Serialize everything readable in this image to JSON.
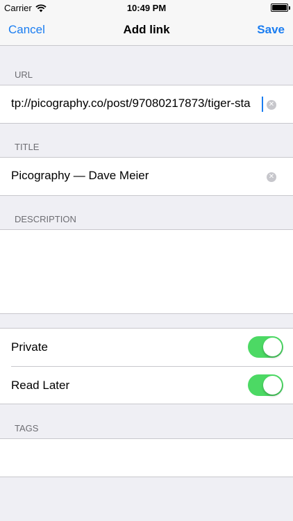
{
  "status_bar": {
    "carrier": "Carrier",
    "time": "10:49 PM"
  },
  "nav": {
    "cancel_label": "Cancel",
    "title": "Add link",
    "save_label": "Save"
  },
  "url": {
    "header": "URL",
    "value": "tp://picography.co/post/97080217873/tiger-sta"
  },
  "title_field": {
    "header": "TITLE",
    "value": "Picography — Dave Meier"
  },
  "description": {
    "header": "DESCRIPTION",
    "value": ""
  },
  "toggles": [
    {
      "label": "Private",
      "on": true
    },
    {
      "label": "Read Later",
      "on": true
    }
  ],
  "tags": {
    "header": "TAGS",
    "value": ""
  },
  "colors": {
    "accent": "#1a7df1",
    "toggle_on": "#4cd964",
    "background": "#efeff4"
  }
}
